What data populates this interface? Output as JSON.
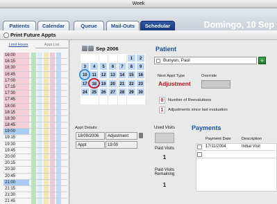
{
  "window": {
    "title": "Week"
  },
  "tabs": [
    {
      "label": "Patients"
    },
    {
      "label": "Calendar"
    },
    {
      "label": "Queue"
    },
    {
      "label": "Mail-Outs"
    },
    {
      "label": "Schedular"
    }
  ],
  "date_display": "Domingo, 10 Sep",
  "print_future": {
    "label": "Print Future Appts"
  },
  "left_tabs": {
    "hours": "Limit Hours",
    "appt": "Appt List"
  },
  "times": [
    "16:00",
    "16:15",
    "16:30",
    "16:45",
    "17:00",
    "17:15",
    "17:30",
    "17:45",
    "18:00",
    "18:15",
    "18:30",
    "18:45",
    "19:00",
    "19:15",
    "19:30",
    "19:45",
    "20:00",
    "20:15",
    "20:30",
    "20:45",
    "21:00",
    "21:15",
    "21:30",
    "21:45"
  ],
  "calendar": {
    "month_label": "Sep 2006",
    "days": [
      "1",
      "2",
      "3",
      "4",
      "5",
      "6",
      "7",
      "8",
      "9",
      "10",
      "11",
      "12",
      "13",
      "14",
      "15",
      "16",
      "17",
      "18",
      "19",
      "20",
      "21",
      "22",
      "23",
      "24",
      "25",
      "26",
      "27",
      "28",
      "29",
      "30"
    ],
    "today": "10",
    "selected": "18"
  },
  "patient": {
    "title": "Patient",
    "name": "Bunyon, Paul",
    "add_label": "+",
    "next_type_label": "Next Appt Type",
    "next_type_value": "Adjustment",
    "override_label": "Override",
    "reeval_count": "0",
    "reeval_label": "Number of Reevalutions",
    "adj_count": "1",
    "adj_label": "Adjustments since last evaluation"
  },
  "appt_details": {
    "label": "Appt Details:",
    "date": "18/09/2006",
    "type": "Adjustment",
    "time_label": "Appt",
    "time": "19:00"
  },
  "visits": {
    "used_label": "Used Visits",
    "paid_label": "Paid Visits",
    "paid_value": "1",
    "paid_remaining_label": "Paid Visits Remaining",
    "paid_remaining_value": "1"
  },
  "payments": {
    "title": "Payments",
    "col_date": "Payment Date",
    "col_desc": "Description",
    "rows": [
      {
        "date": "17/11/2004",
        "desc": "Initial Visit"
      },
      {
        "date": "",
        "desc": ""
      }
    ]
  },
  "colors": {
    "accent": "#1b52a4",
    "alert": "#b01818",
    "today_ring": "#2f8fdc",
    "selected_ring": "#c21a2a"
  }
}
